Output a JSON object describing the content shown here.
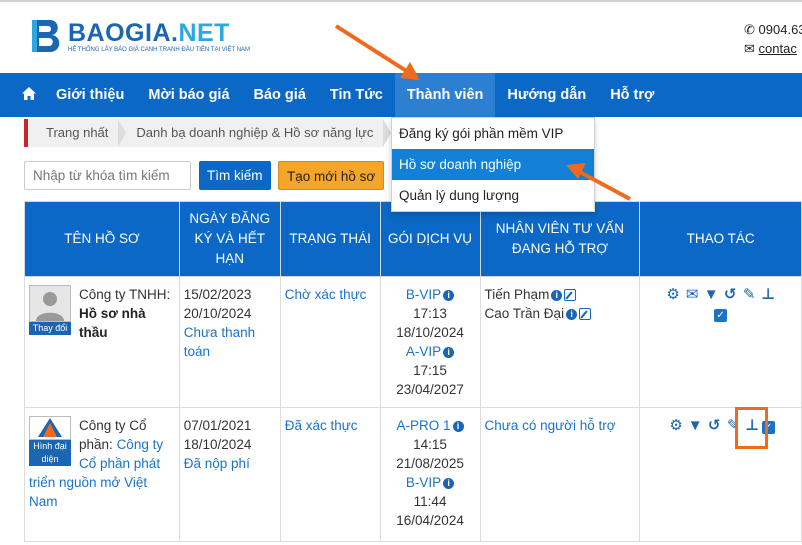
{
  "header": {
    "logo_name_a": "BAOGIA",
    "logo_name_dot": ".",
    "logo_name_b": "NET",
    "logo_tagline": "HỆ THỐNG LẤY BÁO GIÁ CẠNH TRANH ĐẦU TIÊN TẠI VIỆT NAM",
    "phone": "0904.63",
    "contact": "contac"
  },
  "nav": {
    "items": [
      {
        "label": "Giới thiệu"
      },
      {
        "label": "Mời báo giá"
      },
      {
        "label": "Báo giá"
      },
      {
        "label": "Tin Tức"
      },
      {
        "label": "Thành viên"
      },
      {
        "label": "Hướng dẫn"
      },
      {
        "label": "Hỗ trợ"
      }
    ]
  },
  "breadcrumb": {
    "items": [
      {
        "label": "Trang nhất"
      },
      {
        "label": "Danh bạ doanh nghiệp & Hồ sơ năng lực"
      }
    ]
  },
  "dropdown": {
    "items": [
      {
        "label": "Đăng ký gói phần mềm VIP"
      },
      {
        "label": "Hồ sơ doanh nghiệp"
      },
      {
        "label": "Quản lý dung lượng"
      }
    ]
  },
  "search": {
    "placeholder": "Nhập từ khóa tìm kiếm",
    "search_label": "Tìm kiếm",
    "new_label": "Tạo mới hồ sơ"
  },
  "table": {
    "headers": [
      "TÊN HỒ SƠ",
      "NGÀY ĐĂNG KÝ VÀ HẾT HẠN",
      "TRẠNG THÁI",
      "GÓI DỊCH VỤ",
      "NHÂN VIÊN TƯ VẤN ĐANG HỖ TRỢ",
      "THAO TÁC"
    ],
    "rows": [
      {
        "avatar_label": "Thay đổi",
        "name_prefix": "Công ty TNHH:",
        "name_main": "Hồ sơ nhà thầu",
        "date_reg": "15/02/2023",
        "date_exp": "20/10/2024",
        "date_note": "Chưa thanh toán",
        "status": "Chờ xác thực",
        "pkg1": "B-VIP",
        "pkg1_time": "17:13",
        "pkg1_date": "18/10/2024",
        "pkg2": "A-VIP",
        "pkg2_time": "17:15",
        "pkg2_date": "23/04/2027",
        "staff1": "Tiến Phạm",
        "staff2": "Cao Trần Đại"
      },
      {
        "avatar_label": "Hình đại diện",
        "name_prefix": "Công ty Cổ phần:",
        "name_link": "Công ty Cổ phần phát triển nguồn mở Việt Nam",
        "date_reg": "07/01/2021",
        "date_exp": "18/10/2024",
        "date_note": "Đã nộp phí",
        "status": "Đã xác thực",
        "pkg1": "A-PRO 1",
        "pkg1_time": "14:15",
        "pkg1_date": "21/08/2025",
        "pkg2": "B-VIP",
        "pkg2_time": "11:44",
        "pkg2_date": "16/04/2024",
        "staff_none": "Chưa có người hỗ trợ"
      }
    ]
  },
  "colors": {
    "brand_blue": "#0b68c6",
    "accent_orange": "#ee6a1c",
    "button_orange": "#f4a62a",
    "breadcrumb_red": "#c9262c"
  }
}
